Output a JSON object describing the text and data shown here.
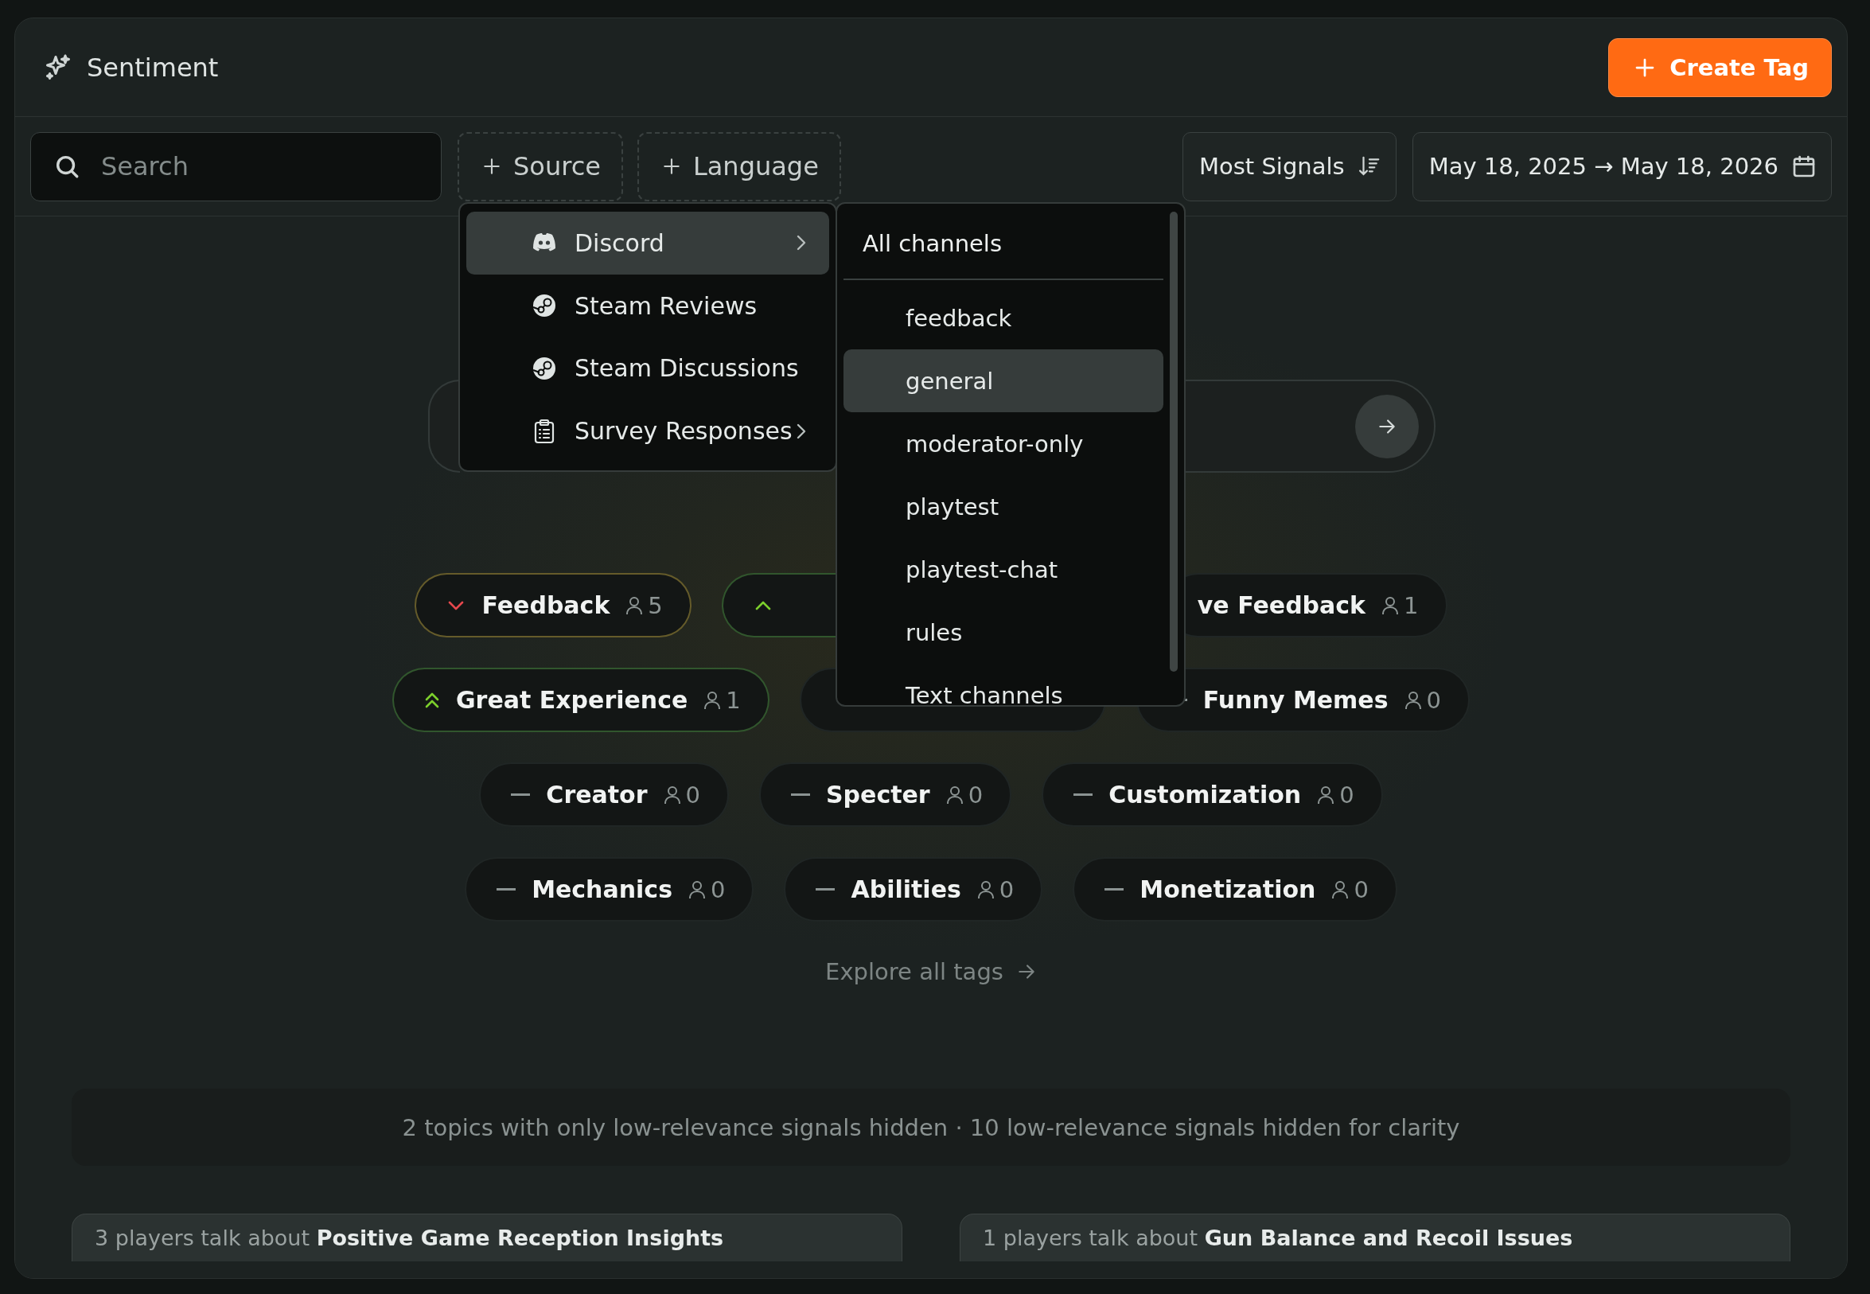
{
  "header": {
    "title": "Sentiment",
    "create_button": "Create Tag"
  },
  "toolbar": {
    "search": {
      "placeholder": "Search"
    },
    "filters": [
      "Source",
      "Language"
    ],
    "sort": "Most Signals",
    "date_start": "May 18, 2025",
    "date_arrow": "→",
    "date_end": "May 18, 2026"
  },
  "source_menu": {
    "items": [
      {
        "label": "Discord",
        "kind": "discord",
        "selected": true,
        "submenu": true
      },
      {
        "label": "Steam Reviews",
        "kind": "steam",
        "selected": false,
        "submenu": false
      },
      {
        "label": "Steam Discussions",
        "kind": "steam",
        "selected": false,
        "submenu": false
      },
      {
        "label": "Survey Responses",
        "kind": "clipboard",
        "selected": false,
        "submenu": true
      }
    ]
  },
  "channel_menu": {
    "all_label": "All channels",
    "items": [
      {
        "label": "feedback",
        "selected": false
      },
      {
        "label": "general",
        "selected": true
      },
      {
        "label": "moderator-only",
        "selected": false
      },
      {
        "label": "playtest",
        "selected": false
      },
      {
        "label": "playtest-chat",
        "selected": false
      },
      {
        "label": "rules",
        "selected": false
      },
      {
        "label": "Text channels",
        "selected": false
      }
    ]
  },
  "tag_rows": [
    [
      {
        "label": "Feedback",
        "count": "5",
        "kind": "down"
      },
      {
        "kind": "up"
      },
      {
        "label": "ve Feedback",
        "count": "1"
      }
    ],
    [
      {
        "label": "Great Experience",
        "count": "1",
        "kind": "strong-up"
      },
      {},
      {
        "label": "Funny Memes",
        "count": "0",
        "kind": "flat"
      }
    ],
    [
      {
        "label": "Creator",
        "count": "0",
        "kind": "flat"
      },
      {
        "label": "Specter",
        "count": "0",
        "kind": "flat"
      },
      {
        "label": "Customization",
        "count": "0",
        "kind": "flat"
      }
    ],
    [
      {
        "label": "Mechanics",
        "count": "0",
        "kind": "flat"
      },
      {
        "label": "Abilities",
        "count": "0",
        "kind": "flat"
      },
      {
        "label": "Monetization",
        "count": "0",
        "kind": "flat"
      }
    ]
  ],
  "explore_link": "Explore all tags",
  "notice": "2 topics with only low-relevance signals hidden · 10 low-relevance signals hidden for clarity",
  "topic_cards": [
    {
      "text": "3 players talk about **Positive Game Reception Insights**"
    },
    {
      "text": "1 players talk about **Gun Balance and Recoil Issues**"
    }
  ]
}
